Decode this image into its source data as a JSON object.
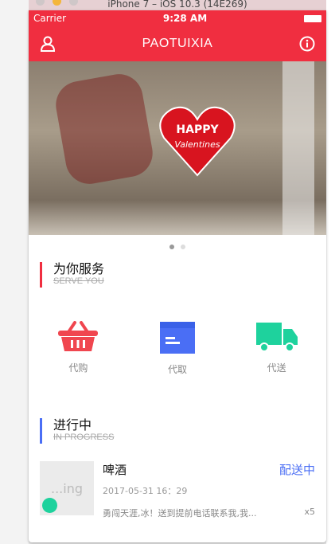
{
  "window": {
    "title": "iPhone 7 – iOS 10.3 (14E269)"
  },
  "status": {
    "carrier": "Carrier",
    "time": "9:28 AM"
  },
  "nav": {
    "title": "PAOTUIXIA",
    "left_icon": "user-icon",
    "right_icon": "info-icon"
  },
  "banner": {
    "heart_top": "HAPPY",
    "heart_bottom": "Valentines",
    "pages": 2,
    "active": 0
  },
  "colors": {
    "brand": "#f02e40",
    "blue": "#4a6ef5",
    "green": "#1ed29d"
  },
  "services": {
    "title": "为你服务",
    "subtitle": "SERVE YOU",
    "items": [
      {
        "label": "代购",
        "icon": "basket-icon"
      },
      {
        "label": "代取",
        "icon": "box-icon"
      },
      {
        "label": "代送",
        "icon": "truck-icon"
      }
    ]
  },
  "progress": {
    "title": "进行中",
    "subtitle": "IN PROGRESS",
    "orders": [
      {
        "thumb": "...ing",
        "name": "啤酒",
        "status": "配送中",
        "time": "2017-05-31 16：29",
        "note": "勇闯天涯,冰！送到提前电话联系我,我...",
        "qty": "x5"
      }
    ]
  }
}
